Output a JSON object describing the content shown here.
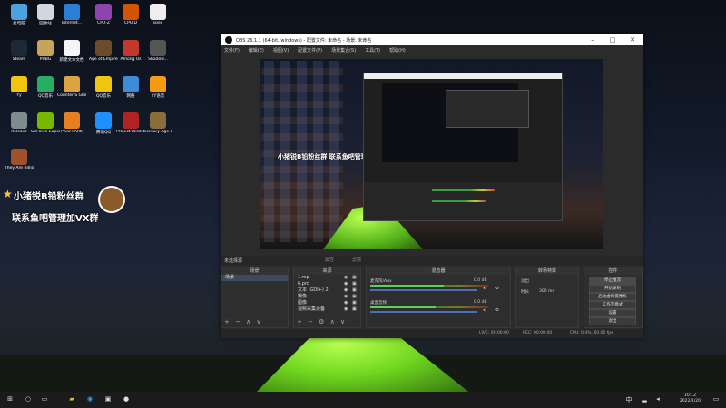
{
  "desktop": {
    "icons": [
      {
        "label": "此电脑",
        "color": "#4aa3df"
      },
      {
        "label": "回收站",
        "color": "#cfd8dc"
      },
      {
        "label": "Internet...",
        "color": "#2a7fd4"
      },
      {
        "label": "CPU-Z",
        "color": "#8e44ad"
      },
      {
        "label": "CPUID",
        "color": "#d35400"
      },
      {
        "label": "spec",
        "color": "#eeeeee"
      },
      {
        "label": "Steam",
        "color": "#1b2838"
      },
      {
        "label": "PUBG",
        "color": "#c8a35a"
      },
      {
        "label": "新建文本文档",
        "color": "#f5f5f5"
      },
      {
        "label": "Age of Empires IV",
        "color": "#6b4b2a"
      },
      {
        "label": "Among Us",
        "color": "#c0392b"
      },
      {
        "label": "Shadow...",
        "color": "#555555"
      },
      {
        "label": "Yy",
        "color": "#f1c40f"
      },
      {
        "label": "QQ音乐",
        "color": "#27ae60"
      },
      {
        "label": "Counter-S Global Off...",
        "color": "#d9a441"
      },
      {
        "label": "QQ音乐",
        "color": "#f1c40f"
      },
      {
        "label": "网络",
        "color": "#3d8bd9"
      },
      {
        "label": "YY语音",
        "color": "#f39c12"
      },
      {
        "label": "Release",
        "color": "#7f8c8d"
      },
      {
        "label": "GeForce Experience",
        "color": "#76b900"
      },
      {
        "label": "PICO PARK",
        "color": "#e67e22"
      },
      {
        "label": "腾讯QQ",
        "color": "#1e90ff"
      },
      {
        "label": "Project Winter",
        "color": "#b22222"
      },
      {
        "label": "Century Age of Empires",
        "color": "#8b6d3a"
      },
      {
        "label": "They Are Billions",
        "color": "#a0522d"
      }
    ],
    "banner_line1": "小猪锐B铅粉丝群",
    "banner_line2": "联系鱼吧管理加VX群"
  },
  "obs": {
    "title": "OBS 26.1.1 (64-bit, windows) - 配置文件: 未命名 - 场景: 未命名",
    "menu": [
      "文件(F)",
      "编辑(E)",
      "视图(V)",
      "配置文件(P)",
      "场景集合(S)",
      "工具(T)",
      "帮助(H)"
    ],
    "preview_caption": "小猪锐B铅粉丝群 联系鱼吧管理加VX群",
    "scene_bar_label": "未选择源",
    "scene_bar_buttons": [
      "属性",
      "滤镜"
    ],
    "docks": {
      "scenes": {
        "title": "场景",
        "items": [
          "场景"
        ]
      },
      "sources": {
        "title": "来源",
        "items": [
          "1.mp",
          "6.pro",
          "文本 (GDI+) 2",
          "摄像",
          "图像",
          "视频采集设备"
        ]
      },
      "mixer": {
        "title": "混音器",
        "channels": [
          {
            "name": "麦克风/Aux",
            "db": "0.0 dB",
            "level": 0.62
          },
          {
            "name": "桌面音频",
            "db": "0.0 dB",
            "level": 0.55
          }
        ]
      },
      "transitions": {
        "title": "转场特效",
        "type": "淡出",
        "duration_label": "时长",
        "duration": "300 ms"
      },
      "controls": {
        "title": "控件",
        "buttons": [
          "停止推流",
          "开始录制",
          "启动虚拟摄像机",
          "工作室模式",
          "设置",
          "退出"
        ]
      }
    },
    "status": {
      "live": "LIVE: 00:00:00",
      "rec": "REC: 00:00:00",
      "cpu": "CPU: 0.4%, 60.00 fps"
    }
  },
  "taskbar": {
    "time": "10:12",
    "date": "2022/1/20",
    "lang": "中"
  }
}
